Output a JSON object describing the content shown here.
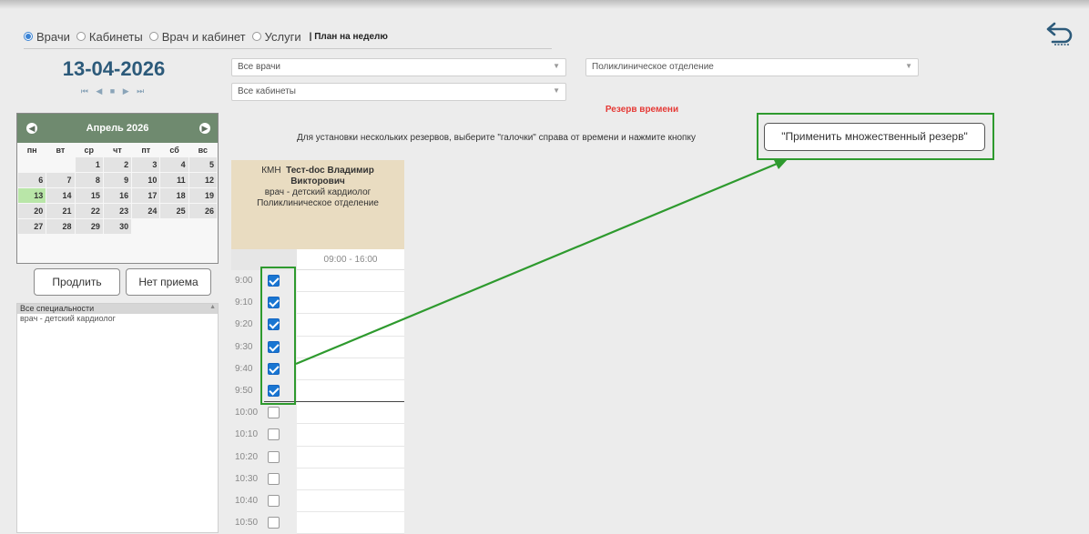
{
  "view_options": {
    "items": [
      {
        "label": "Врачи",
        "checked": true
      },
      {
        "label": "Кабинеты",
        "checked": false
      },
      {
        "label": "Врач и кабинет",
        "checked": false
      },
      {
        "label": "Услуги",
        "checked": false
      }
    ],
    "plan_label": "| План на неделю"
  },
  "date": {
    "current": "13-04-2026",
    "nav": [
      "⏮",
      "◀",
      "■",
      "▶",
      "⏭"
    ]
  },
  "filters": {
    "doctors": "Все врачи",
    "department": "Поликлиническое отделение",
    "cabinets": "Все кабинеты"
  },
  "calendar": {
    "month_label": "Апрель 2026",
    "weekdays": [
      "пн",
      "вт",
      "ср",
      "чт",
      "пт",
      "сб",
      "вс"
    ],
    "weeks": [
      [
        "",
        "",
        "1",
        "2",
        "3",
        "4",
        "5"
      ],
      [
        "6",
        "7",
        "8",
        "9",
        "10",
        "11",
        "12"
      ],
      [
        "13",
        "14",
        "15",
        "16",
        "17",
        "18",
        "19"
      ],
      [
        "20",
        "21",
        "22",
        "23",
        "24",
        "25",
        "26"
      ],
      [
        "27",
        "28",
        "29",
        "30",
        "",
        "",
        ""
      ]
    ],
    "today": "13"
  },
  "buttons": {
    "extend": "Продлить",
    "no_reception": "Нет приема"
  },
  "specialties": [
    {
      "label": "Все специальности",
      "selected": true
    },
    {
      "label": "врач - детский кардиолог",
      "selected": false
    }
  ],
  "reserve": {
    "title": "Резерв времени",
    "instruction": "Для установки нескольких резервов, выберите \"галочки\" справа от времени и нажмите кнопку",
    "apply_button": "\"Применить множественный резерв\""
  },
  "doctor": {
    "prefix": "КМН",
    "name_line1": "Тест-doc Владимир",
    "name_line2": "Викторович",
    "specialty": "врач - детский кардиолог",
    "department": "Поликлиническое отделение",
    "work_hours": "09:00 - 16:00"
  },
  "slots": [
    {
      "time": "9:00",
      "checked": true
    },
    {
      "time": "9:10",
      "checked": true
    },
    {
      "time": "9:20",
      "checked": true
    },
    {
      "time": "9:30",
      "checked": true
    },
    {
      "time": "9:40",
      "checked": true
    },
    {
      "time": "9:50",
      "checked": true
    },
    {
      "time": "10:00",
      "checked": false
    },
    {
      "time": "10:10",
      "checked": false
    },
    {
      "time": "10:20",
      "checked": false
    },
    {
      "time": "10:30",
      "checked": false
    },
    {
      "time": "10:40",
      "checked": false
    },
    {
      "time": "10:50",
      "checked": false
    }
  ],
  "colors": {
    "accent_blue": "#1976d2",
    "highlight_green": "#2e9a2e",
    "reserve_red": "#e53935",
    "today_green": "#b9e6a8",
    "doctor_card": "#e9dcc1"
  }
}
